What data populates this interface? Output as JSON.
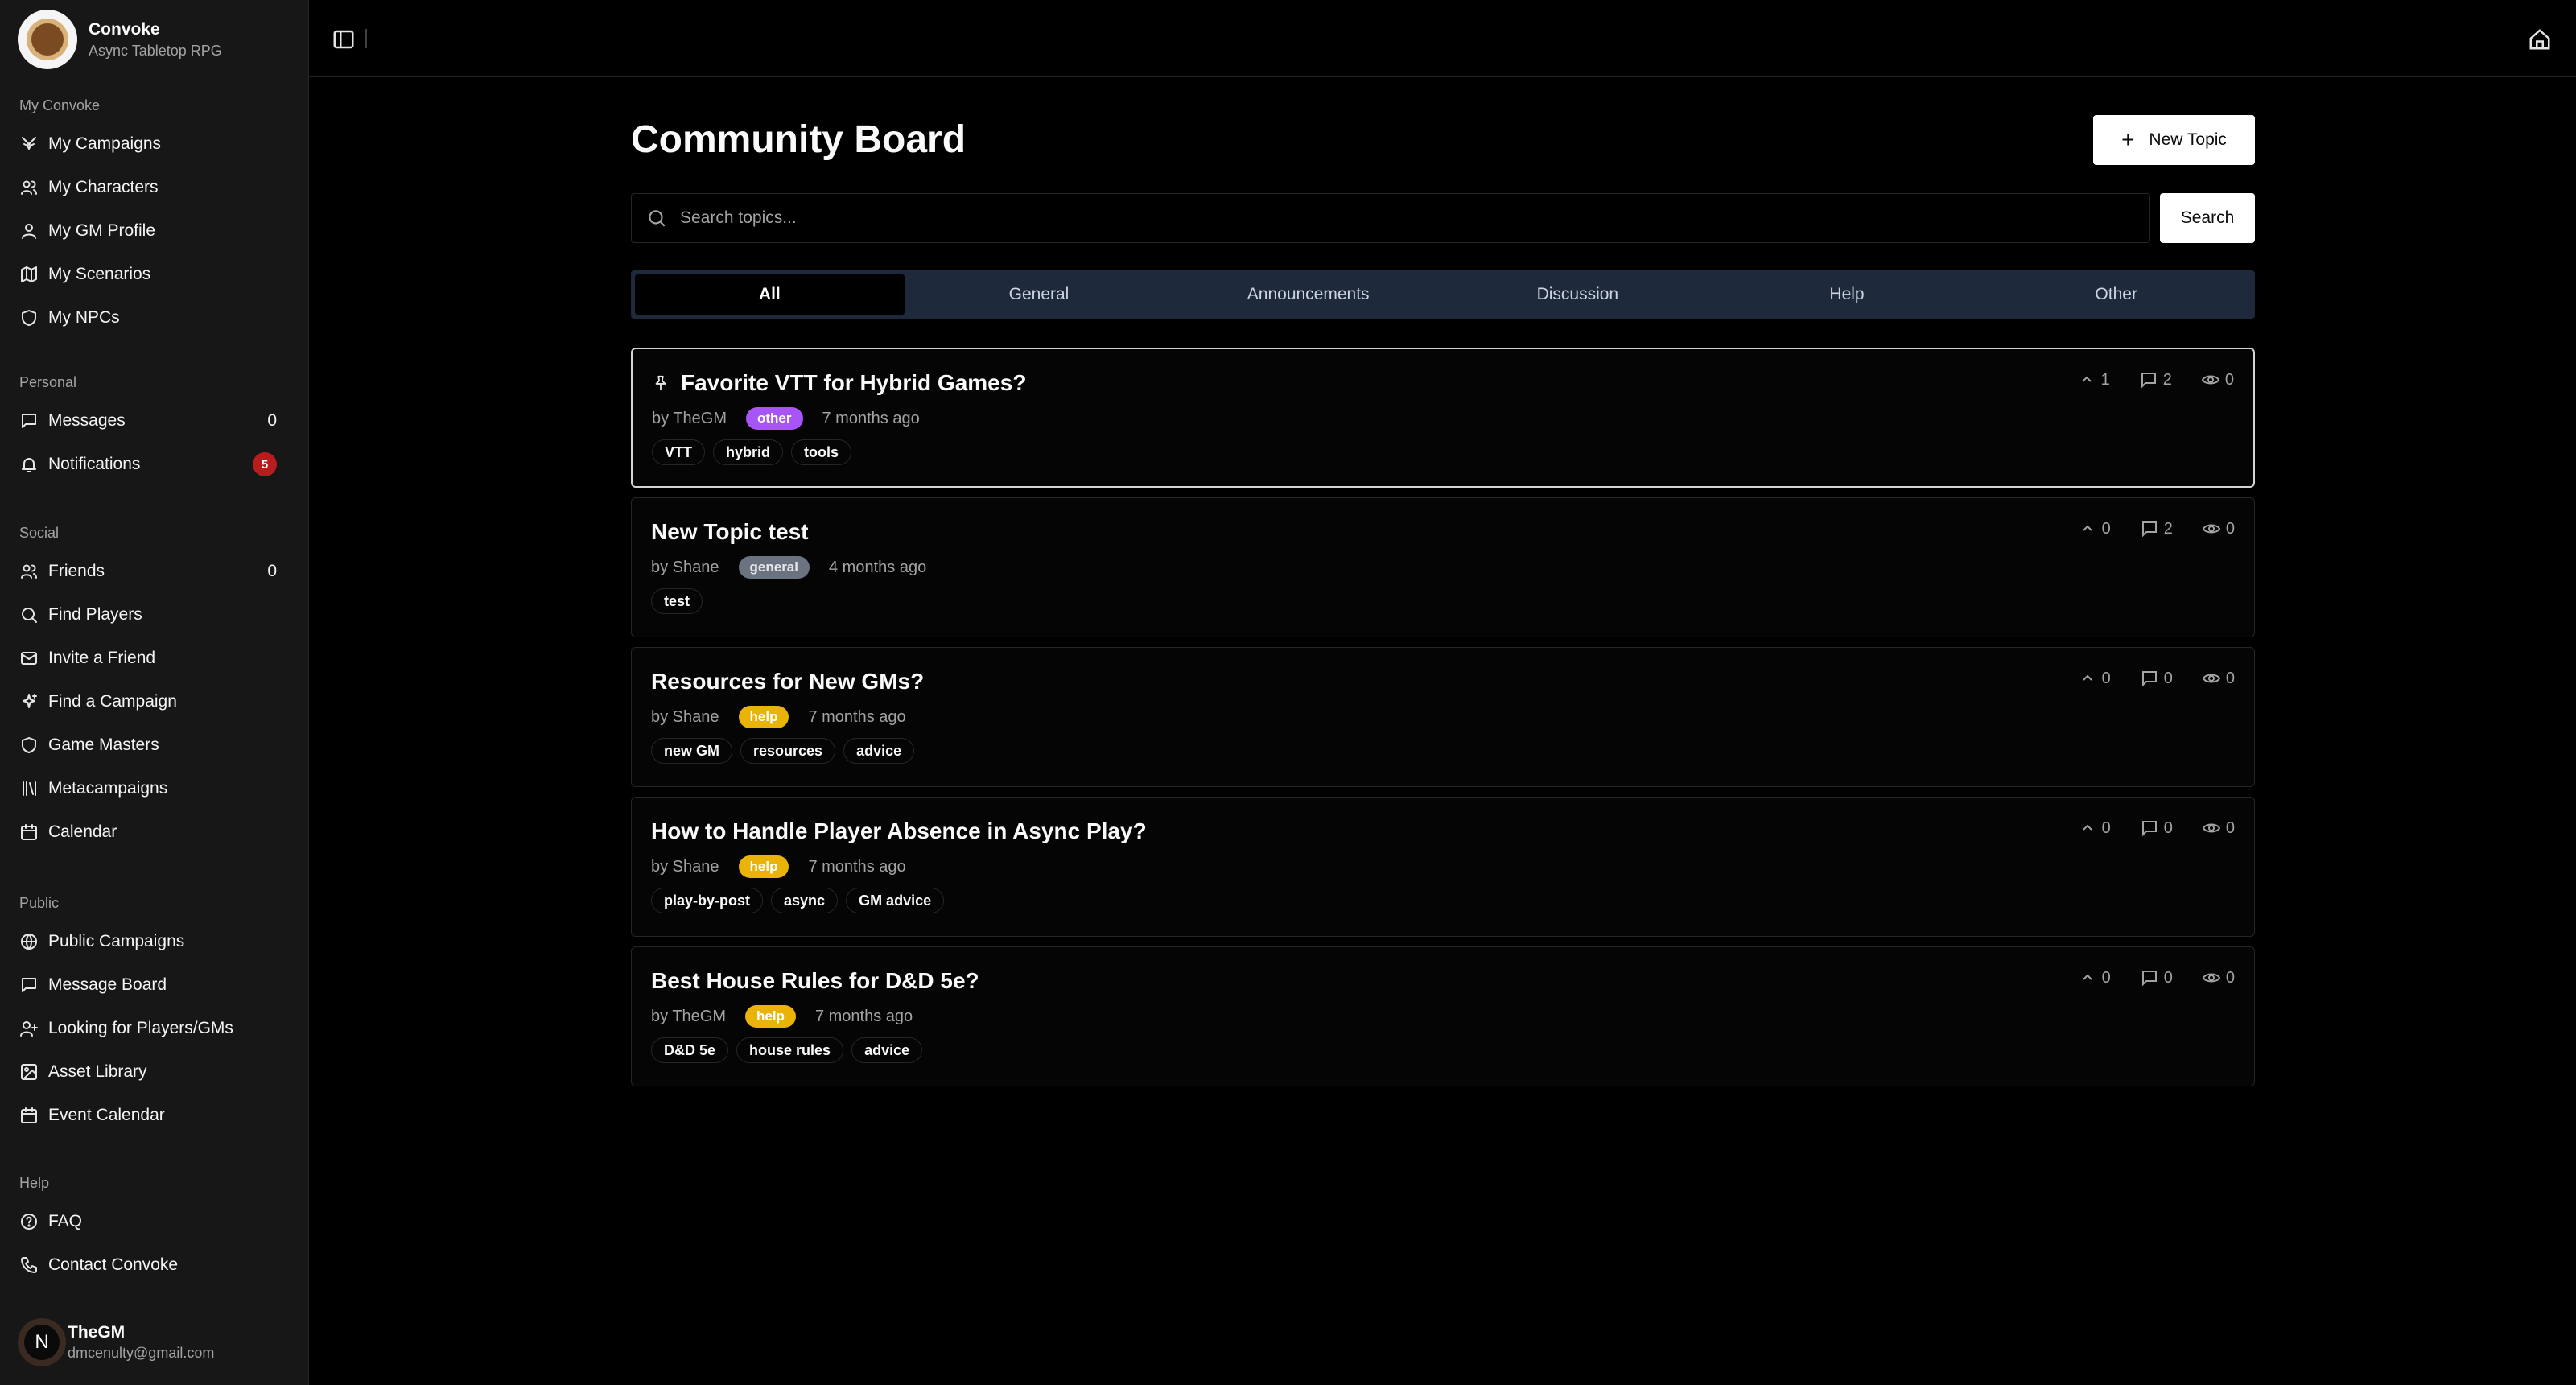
{
  "brand": {
    "name": "Convoke",
    "subtitle": "Async Tabletop RPG"
  },
  "sidebar": {
    "groups": [
      {
        "label": "My Convoke",
        "items": [
          {
            "label": "My Campaigns",
            "icon": "swords-icon"
          },
          {
            "label": "My Characters",
            "icon": "users-icon"
          },
          {
            "label": "My GM Profile",
            "icon": "user-icon"
          },
          {
            "label": "My Scenarios",
            "icon": "map-icon"
          },
          {
            "label": "My NPCs",
            "icon": "shield-icon"
          }
        ]
      },
      {
        "label": "Personal",
        "items": [
          {
            "label": "Messages",
            "icon": "message-icon",
            "count": "0"
          },
          {
            "label": "Notifications",
            "icon": "bell-icon",
            "badge": "5"
          }
        ]
      },
      {
        "label": "Social",
        "items": [
          {
            "label": "Friends",
            "icon": "users-icon",
            "count": "0"
          },
          {
            "label": "Find Players",
            "icon": "search-icon"
          },
          {
            "label": "Invite a Friend",
            "icon": "mail-icon"
          },
          {
            "label": "Find a Campaign",
            "icon": "sparkles-icon"
          },
          {
            "label": "Game Masters",
            "icon": "shield-icon"
          },
          {
            "label": "Metacampaigns",
            "icon": "library-icon"
          },
          {
            "label": "Calendar",
            "icon": "calendar-icon"
          }
        ]
      },
      {
        "label": "Public",
        "items": [
          {
            "label": "Public Campaigns",
            "icon": "globe-icon"
          },
          {
            "label": "Message Board",
            "icon": "message-icon"
          },
          {
            "label": "Looking for Players/GMs",
            "icon": "user-plus-icon"
          },
          {
            "label": "Asset Library",
            "icon": "image-icon"
          },
          {
            "label": "Event Calendar",
            "icon": "calendar-icon"
          }
        ]
      },
      {
        "label": "Help",
        "items": [
          {
            "label": "FAQ",
            "icon": "help-circle-icon"
          },
          {
            "label": "Contact Convoke",
            "icon": "phone-icon"
          }
        ]
      }
    ]
  },
  "user": {
    "name": "TheGM",
    "email": "dmcenulty@gmail.com",
    "initial": "N"
  },
  "page": {
    "title": "Community Board",
    "new_topic_label": "New Topic",
    "search_placeholder": "Search topics...",
    "search_button": "Search"
  },
  "tabs": [
    {
      "label": "All",
      "active": true
    },
    {
      "label": "General"
    },
    {
      "label": "Announcements"
    },
    {
      "label": "Discussion"
    },
    {
      "label": "Help"
    },
    {
      "label": "Other"
    }
  ],
  "topics": [
    {
      "title": "Favorite VTT for Hybrid Games?",
      "pinned": true,
      "author": "by TheGM",
      "category": "other",
      "time": "7 months ago",
      "tags": [
        "VTT",
        "hybrid",
        "tools"
      ],
      "votes": "1",
      "replies": "2",
      "views": "0"
    },
    {
      "title": "New Topic test",
      "pinned": false,
      "author": "by Shane",
      "category": "general",
      "time": "4 months ago",
      "tags": [
        "test"
      ],
      "votes": "0",
      "replies": "2",
      "views": "0"
    },
    {
      "title": "Resources for New GMs?",
      "pinned": false,
      "author": "by Shane",
      "category": "help",
      "time": "7 months ago",
      "tags": [
        "new GM",
        "resources",
        "advice"
      ],
      "votes": "0",
      "replies": "0",
      "views": "0"
    },
    {
      "title": "How to Handle Player Absence in Async Play?",
      "pinned": false,
      "author": "by Shane",
      "category": "help",
      "time": "7 months ago",
      "tags": [
        "play-by-post",
        "async",
        "GM advice"
      ],
      "votes": "0",
      "replies": "0",
      "views": "0"
    },
    {
      "title": "Best House Rules for D&D 5e?",
      "pinned": false,
      "author": "by TheGM",
      "category": "help",
      "time": "7 months ago",
      "tags": [
        "D&D 5e",
        "house rules",
        "advice"
      ],
      "votes": "0",
      "replies": "0",
      "views": "0"
    }
  ],
  "colors": {
    "category_other": "#a855f7",
    "category_general": "#6b7280",
    "category_help": "#eab308",
    "notification_badge": "#b91c1c",
    "tab_bar": "#1e2a3b"
  }
}
